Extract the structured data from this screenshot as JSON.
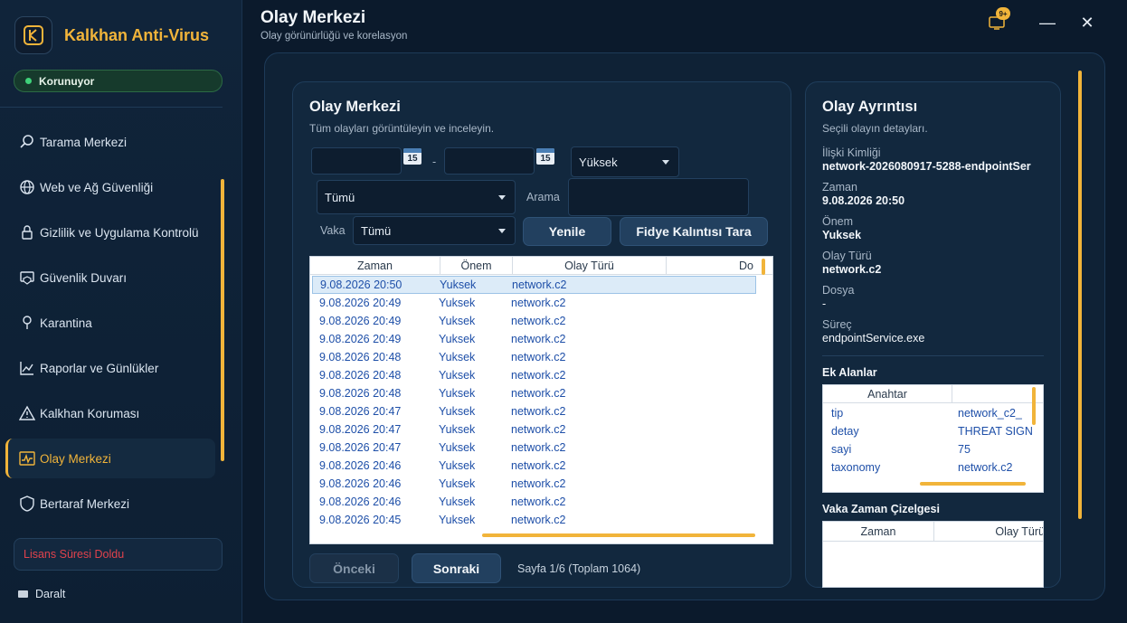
{
  "app": {
    "title": "Kalkhan Anti-Virus",
    "status": "Korunuyor"
  },
  "sidebar": {
    "items": [
      {
        "label": "Tarama Merkezi",
        "icon": "search-icon"
      },
      {
        "label": "Web ve Ağ Güvenliği",
        "icon": "globe-icon"
      },
      {
        "label": "Gizlilik ve Uygulama Kontrolü",
        "icon": "lock-icon"
      },
      {
        "label": "Güvenlik Duvarı",
        "icon": "firewall-icon"
      },
      {
        "label": "Karantina",
        "icon": "pin-icon"
      },
      {
        "label": "Raporlar ve Günlükler",
        "icon": "chart-icon"
      },
      {
        "label": "Kalkhan Koruması",
        "icon": "warning-icon"
      },
      {
        "label": "Olay Merkezi",
        "icon": "activity-icon",
        "active": true
      },
      {
        "label": "Bertaraf Merkezi",
        "icon": "shield-icon"
      }
    ],
    "license": "Lisans Süresi Doldu",
    "collapse": "Daralt"
  },
  "header": {
    "title": "Olay Merkezi",
    "subtitle": "Olay görünürlüğü ve korelasyon",
    "badge": "9+"
  },
  "events": {
    "title": "Olay Merkezi",
    "subtitle": "Tüm olayları görüntüleyin ve inceleyin.",
    "calendar_day": "15",
    "date_sep": "-",
    "severity": "Yüksek",
    "type_filter": "Tümü",
    "search_label": "Arama",
    "case_label": "Vaka",
    "case_filter": "Tümü",
    "refresh": "Yenile",
    "ransom_scan": "Fidye Kalıntısı Tara",
    "columns": [
      "Zaman",
      "Önem",
      "Olay Türü",
      "Do"
    ],
    "rows": [
      {
        "time": "9.08.2026 20:50",
        "severity": "Yuksek",
        "type": "network.c2"
      },
      {
        "time": "9.08.2026 20:49",
        "severity": "Yuksek",
        "type": "network.c2"
      },
      {
        "time": "9.08.2026 20:49",
        "severity": "Yuksek",
        "type": "network.c2"
      },
      {
        "time": "9.08.2026 20:49",
        "severity": "Yuksek",
        "type": "network.c2"
      },
      {
        "time": "9.08.2026 20:48",
        "severity": "Yuksek",
        "type": "network.c2"
      },
      {
        "time": "9.08.2026 20:48",
        "severity": "Yuksek",
        "type": "network.c2"
      },
      {
        "time": "9.08.2026 20:48",
        "severity": "Yuksek",
        "type": "network.c2"
      },
      {
        "time": "9.08.2026 20:47",
        "severity": "Yuksek",
        "type": "network.c2"
      },
      {
        "time": "9.08.2026 20:47",
        "severity": "Yuksek",
        "type": "network.c2"
      },
      {
        "time": "9.08.2026 20:47",
        "severity": "Yuksek",
        "type": "network.c2"
      },
      {
        "time": "9.08.2026 20:46",
        "severity": "Yuksek",
        "type": "network.c2"
      },
      {
        "time": "9.08.2026 20:46",
        "severity": "Yuksek",
        "type": "network.c2"
      },
      {
        "time": "9.08.2026 20:46",
        "severity": "Yuksek",
        "type": "network.c2"
      },
      {
        "time": "9.08.2026 20:45",
        "severity": "Yuksek",
        "type": "network.c2"
      }
    ],
    "prev": "Önceki",
    "next": "Sonraki",
    "page_info": "Sayfa 1/6 (Toplam 1064)"
  },
  "detail": {
    "title": "Olay Ayrıntısı",
    "subtitle": "Seçili olayın detayları.",
    "fields": [
      {
        "label": "İlişki Kimliği",
        "value": "network-2026080917-5288-endpointSer"
      },
      {
        "label": "Zaman",
        "value": "9.08.2026 20:50"
      },
      {
        "label": "Önem",
        "value": "Yuksek"
      },
      {
        "label": "Olay Türü",
        "value": "network.c2"
      },
      {
        "label": "Dosya",
        "value": "-"
      },
      {
        "label": "Süreç",
        "value": "endpointService.exe"
      }
    ],
    "extra_title": "Ek Alanlar",
    "extra_columns": [
      "Anahtar",
      ""
    ],
    "extra_rows": [
      {
        "key": "tip",
        "value": "network_c2_"
      },
      {
        "key": "detay",
        "value": "THREAT SIGN"
      },
      {
        "key": "sayi",
        "value": "75"
      },
      {
        "key": "taxonomy",
        "value": "network.c2"
      }
    ],
    "timeline_title": "Vaka Zaman Çizelgesi",
    "timeline_columns": [
      "Zaman",
      "Olay Türü"
    ]
  },
  "colors": {
    "accent": "#f1b43a",
    "ok": "#3fd27a",
    "danger": "#e0424c"
  }
}
